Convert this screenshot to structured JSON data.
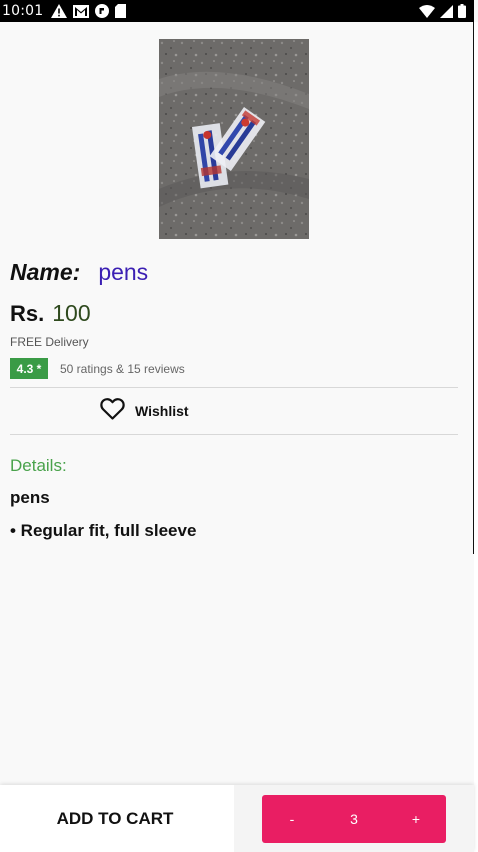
{
  "status_bar": {
    "time": "10:01",
    "left_icons": [
      "alert-icon",
      "gmail-icon",
      "app-icon",
      "sd-card-icon"
    ],
    "right_icons": [
      "wifi-icon",
      "signal-icon",
      "battery-icon"
    ]
  },
  "product": {
    "image_alt": "pens",
    "name_label": "Name:",
    "name": "pens",
    "currency": "Rs.",
    "price": "100",
    "delivery": "FREE Delivery",
    "rating": "4.3 *",
    "rating_summary": "50 ratings & 15 reviews"
  },
  "wishlist": {
    "icon": "heart-outline-icon",
    "label": "Wishlist"
  },
  "details": {
    "heading": "Details:",
    "title": "pens",
    "bullet": "• Regular fit, full sleeve"
  },
  "bottom_bar": {
    "add_to_cart_label": "ADD TO CART",
    "decrement_label": "-",
    "quantity": "3",
    "increment_label": "+"
  },
  "colors": {
    "accent": "#e91e63",
    "name_color": "#3b1fb3",
    "details_heading": "#49a24b",
    "rating_badge": "#3a9b46"
  }
}
